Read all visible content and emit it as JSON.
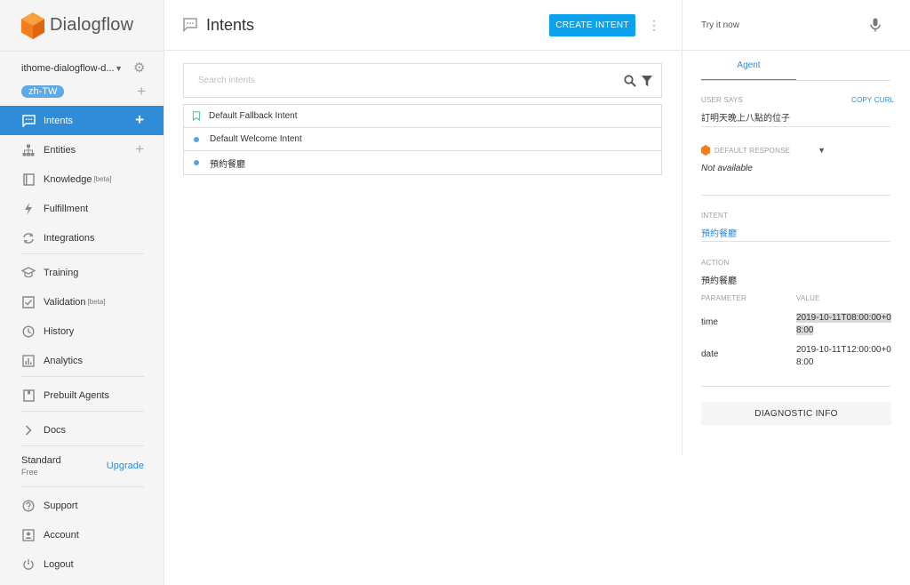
{
  "app": {
    "name": "Dialogflow"
  },
  "agent": {
    "name": "ithome-dialogflow-d...",
    "language": "zh-TW"
  },
  "sidebar": {
    "items": [
      {
        "label": "Intents"
      },
      {
        "label": "Entities"
      },
      {
        "label": "Knowledge",
        "badge": "[beta]"
      },
      {
        "label": "Fulfillment"
      },
      {
        "label": "Integrations"
      },
      {
        "label": "Training"
      },
      {
        "label": "Validation",
        "badge": "[beta]"
      },
      {
        "label": "History"
      },
      {
        "label": "Analytics"
      },
      {
        "label": "Prebuilt Agents"
      },
      {
        "label": "Docs"
      }
    ],
    "plan": {
      "title": "Standard",
      "subtitle": "Free",
      "upgrade_label": "Upgrade"
    },
    "bottom": [
      {
        "label": "Support"
      },
      {
        "label": "Account"
      },
      {
        "label": "Logout"
      }
    ]
  },
  "main": {
    "title": "Intents",
    "create_label": "CREATE INTENT",
    "search_placeholder": "Search intents",
    "intents": [
      {
        "name": "Default Fallback Intent"
      },
      {
        "name": "Default Welcome Intent"
      },
      {
        "name": "預約餐廳"
      }
    ]
  },
  "right": {
    "try_placeholder": "Try it now",
    "tab_label": "Agent",
    "user_says_label": "USER SAYS",
    "copy_curl_label": "COPY CURL",
    "user_says_text": "訂明天晚上八點的位子",
    "default_response_label": "DEFAULT RESPONSE",
    "default_response_value": "Not available",
    "intent_label": "INTENT",
    "intent_value": "預約餐廳",
    "action_label": "ACTION",
    "action_value": "預約餐廳",
    "parameter_header": "PARAMETER",
    "value_header": "VALUE",
    "parameters": [
      {
        "name": "time",
        "value_line1": "2019-10-11T08:00:00+0",
        "value_line2": "8:00"
      },
      {
        "name": "date",
        "value_line1": "2019-10-11T12:00:00+0",
        "value_line2": "8:00"
      }
    ],
    "diagnostic_label": "DIAGNOSTIC INFO"
  },
  "colors": {
    "accent": "#2e8cd9",
    "button": "#0ba2ed",
    "chip": "#5cabe8",
    "logo": "#f47e1e"
  }
}
